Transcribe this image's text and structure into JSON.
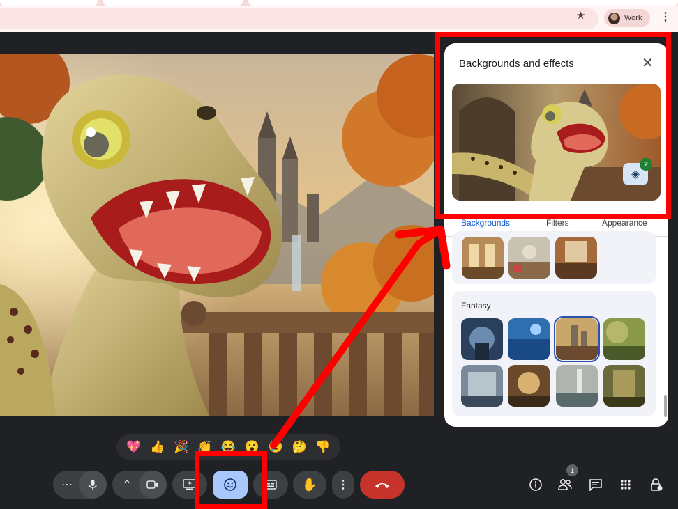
{
  "browser": {
    "profile_label": "Work",
    "star_icon": "star-icon",
    "menu_icon": "kebab-icon"
  },
  "effects_panel": {
    "title": "Backgrounds and effects",
    "close_icon": "close-icon",
    "layers_badge_count": "2",
    "tabs": [
      {
        "label": "Backgrounds",
        "active": true
      },
      {
        "label": "Filters",
        "active": false
      },
      {
        "label": "Appearance",
        "active": false
      }
    ],
    "fantasy_section": {
      "title": "Fantasy",
      "selected_index": 2
    }
  },
  "reactions": [
    "💖",
    "👍",
    "🎉",
    "👏",
    "😂",
    "😮",
    "😢",
    "🤔",
    "👎"
  ],
  "controls": {
    "more_left_icon": "more-horizontal-icon",
    "mic_icon": "mic-icon",
    "camera_icon": "camera-icon",
    "present_icon": "present-screen-icon",
    "emoji_icon": "emoji-icon",
    "captions_icon": "captions-icon",
    "raise_hand_icon": "raise-hand-icon",
    "more_options_icon": "more-vertical-icon",
    "end_call_icon": "end-call-icon"
  },
  "side_controls": {
    "info_icon": "info-icon",
    "people_icon": "people-icon",
    "people_count": "1",
    "chat_icon": "chat-icon",
    "activities_icon": "apps-icon",
    "host_controls_icon": "lock-person-icon"
  },
  "colors": {
    "annotation": "#ff0000",
    "emoji_active": "#a8c7fa",
    "end_call": "#c5332b",
    "accent": "#0b57d0"
  }
}
